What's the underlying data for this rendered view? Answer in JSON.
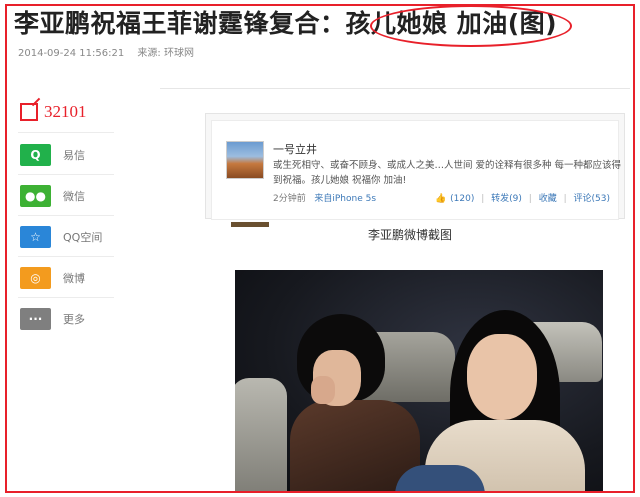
{
  "article": {
    "title": "李亚鹏祝福王菲谢霆锋复合：孩儿她娘 加油(图)",
    "date": "2014-09-24 11:56:21",
    "source": "来源: 环球网"
  },
  "share": {
    "count": "32101",
    "items": [
      {
        "label": "易信",
        "icon": "yixin-icon",
        "color": "#21b14b",
        "glyph": "Q"
      },
      {
        "label": "微信",
        "icon": "wechat-icon",
        "color": "#3db134",
        "glyph": "●●"
      },
      {
        "label": "QQ空间",
        "icon": "qzone-icon",
        "color": "#2a86d8",
        "glyph": "☆"
      },
      {
        "label": "微博",
        "icon": "weibo-icon",
        "color": "#f39b1e",
        "glyph": "◎"
      },
      {
        "label": "更多",
        "icon": "more-icon",
        "color": "#7f7f7f",
        "glyph": "···"
      }
    ]
  },
  "weibo_post": {
    "name": "一号立井",
    "text": "或生死相守、或奋不顾身、或成人之美…人世间 爱的诠释有很多种 每一种都应该得到祝福。孩儿她娘 祝福你 加油!",
    "time": "2分钟前",
    "source": "来自iPhone 5s",
    "actions": {
      "like": "(120)",
      "repost": "转发(9)",
      "favorite": "收藏",
      "comment": "评论(53)"
    }
  },
  "caption": "李亚鹏微博截图",
  "colors": {
    "accent_red": "#e8202a",
    "link_blue": "#3d79b8"
  }
}
